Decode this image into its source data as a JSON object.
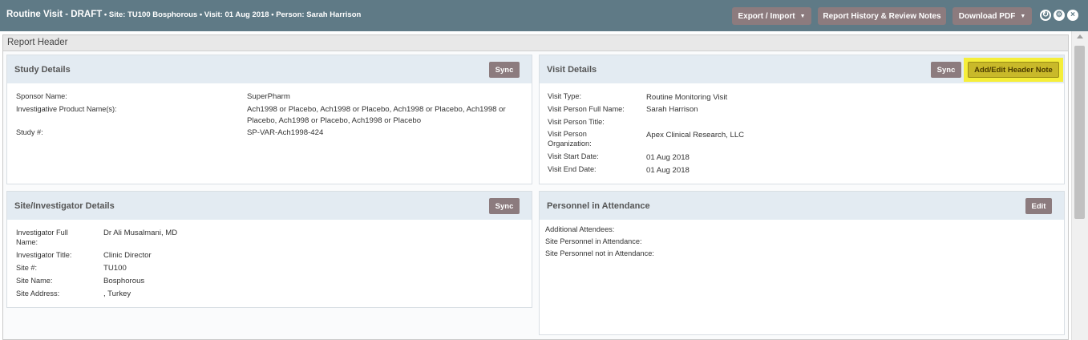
{
  "header": {
    "title": "Routine Visit - DRAFT",
    "meta": " • Site: TU100 Bosphorous • Visit: 01 Aug 2018 • Person: Sarah Harrison",
    "export_label": "Export / Import",
    "history_label": "Report History & Review Notes",
    "pdf_label": "Download PDF",
    "caret": "▼",
    "refresh_icon": "↻",
    "settings_icon": "⚙",
    "close_icon": "×"
  },
  "report_header": {
    "title": "Report Header"
  },
  "study_details": {
    "title": "Study Details",
    "sync_label": "Sync",
    "fields": [
      {
        "label": "Sponsor Name:",
        "value": "SuperPharm"
      },
      {
        "label": "Investigative Product Name(s):",
        "value": "Ach1998 or Placebo, Ach1998 or Placebo, Ach1998 or Placebo, Ach1998 or Placebo, Ach1998 or Placebo, Ach1998 or Placebo"
      },
      {
        "label": "Study #:",
        "value": "SP-VAR-Ach1998-424"
      }
    ]
  },
  "visit_details": {
    "title": "Visit Details",
    "sync_label": "Sync",
    "header_note_label": "Add/Edit Header Note",
    "fields": [
      {
        "label": "Visit Type:",
        "value": "Routine Monitoring Visit"
      },
      {
        "label": "Visit Person Full Name:",
        "value": "Sarah Harrison"
      },
      {
        "label": "Visit Person Title:",
        "value": ""
      },
      {
        "label": "Visit Person Organization:",
        "value": "Apex Clinical Research, LLC"
      },
      {
        "label": "Visit Start Date:",
        "value": "01 Aug 2018"
      },
      {
        "label": "Visit End Date:",
        "value": "01 Aug 2018"
      }
    ]
  },
  "site_details": {
    "title": "Site/Investigator Details",
    "sync_label": "Sync",
    "fields": [
      {
        "label": "Investigator Full Name:",
        "value": "Dr Ali Musalmani, MD"
      },
      {
        "label": "Investigator Title:",
        "value": "Clinic Director"
      },
      {
        "label": "Site #:",
        "value": "TU100"
      },
      {
        "label": "Site Name:",
        "value": "Bosphorous"
      },
      {
        "label": "Site Address:",
        "value": ", Turkey"
      }
    ]
  },
  "personnel": {
    "title": "Personnel in Attendance",
    "edit_label": "Edit",
    "fields": [
      {
        "label": "Additional Attendees:"
      },
      {
        "label": "Site Personnel in Attendance:"
      },
      {
        "label": "Site Personnel not in Attendance:"
      }
    ]
  }
}
